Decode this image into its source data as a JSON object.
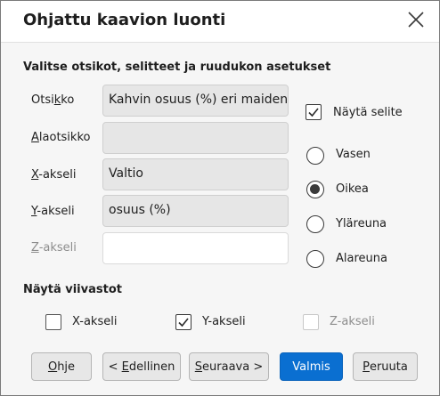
{
  "dialog": {
    "title": "Ohjattu kaavion luonti",
    "close_icon": "close-icon"
  },
  "titles_section": {
    "heading": "Valitse otsikot, selitteet ja ruudukon asetukset",
    "fields": [
      {
        "label_pre": "Otsi",
        "label_u": "k",
        "label_post": "ko",
        "value": "Kahvin osuus (%) eri maiden",
        "enabled": true
      },
      {
        "label_pre": "",
        "label_u": "A",
        "label_post": "laotsikko",
        "value": "",
        "enabled": true
      },
      {
        "label_pre": "",
        "label_u": "X",
        "label_post": "-akseli",
        "value": "Valtio",
        "enabled": true
      },
      {
        "label_pre": "",
        "label_u": "Y",
        "label_post": "-akseli",
        "value": "osuus (%)",
        "enabled": true
      },
      {
        "label_pre": "",
        "label_u": "Z",
        "label_post": "-akseli",
        "value": "",
        "enabled": false
      }
    ]
  },
  "legend": {
    "show_label": "Näytä selite",
    "show_checked": true,
    "positions": [
      {
        "label": "Vasen",
        "selected": false
      },
      {
        "label": "Oikea",
        "selected": true
      },
      {
        "label": "Yläreuna",
        "selected": false
      },
      {
        "label": "Alareuna",
        "selected": false
      }
    ]
  },
  "gridlines": {
    "heading": "Näytä viivastot",
    "items": [
      {
        "label": "X-akseli",
        "checked": false,
        "enabled": true
      },
      {
        "label": "Y-akseli",
        "checked": true,
        "enabled": true
      },
      {
        "label": "Z-akseli",
        "checked": false,
        "enabled": false
      }
    ]
  },
  "buttons": {
    "help_u": "O",
    "help_rest": "hje",
    "prev_pre": "< ",
    "prev_u": "E",
    "prev_rest": "dellinen",
    "next_u": "S",
    "next_rest": "euraava >",
    "finish": "Valmis",
    "cancel_u": "P",
    "cancel_rest": "eruuta"
  },
  "colors": {
    "primary": "#0a6fd1",
    "field_bg": "#e6e6e6",
    "dialog_bg": "#f6f6f6"
  }
}
